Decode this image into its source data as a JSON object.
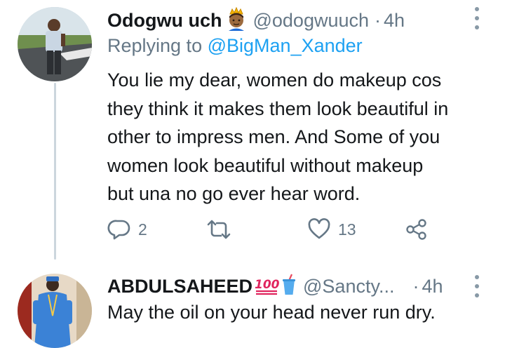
{
  "tweets": [
    {
      "name": "Odogwu uch",
      "name_emoji": "prince-emoji",
      "handle": "@odogwuuch",
      "separator": "·",
      "time": "4h",
      "replying_prefix": "Replying to",
      "replying_handle": "@BigMan_Xander",
      "text_lines": [
        "You lie my dear, women do makeup cos",
        "they think it makes them look beautiful in",
        "other to impress men. And Some of you",
        "women look beautiful without makeup",
        "but una no go ever hear word."
      ],
      "reply_count": "2",
      "retweet_count": "",
      "like_count": "13"
    },
    {
      "name": "ABDULSAHEED",
      "name_emojis": [
        "hundred-points-emoji",
        "cup-with-straw-emoji"
      ],
      "handle": "@Sancty...",
      "separator": "·",
      "time": "4h",
      "text": "May the oil on your head never run dry."
    }
  ],
  "colors": {
    "text": "#14171a",
    "muted": "#657786",
    "link": "#1da1f2",
    "thread_line": "#ccd6dd"
  },
  "icons": [
    "reply-icon",
    "retweet-icon",
    "like-icon",
    "share-icon",
    "more-icon"
  ]
}
